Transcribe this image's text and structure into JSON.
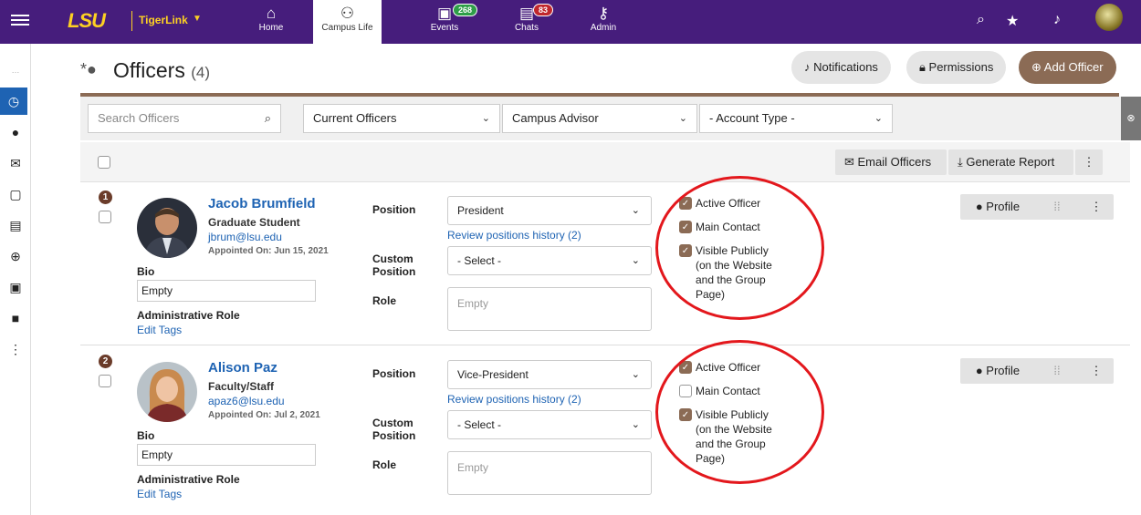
{
  "topbar": {
    "logo": "LSU",
    "brand": "TigerLink",
    "nav": [
      {
        "label": "Home",
        "icon": "home-icon"
      },
      {
        "label": "Campus Life",
        "icon": "campus-life-icon"
      },
      {
        "label": "Events",
        "icon": "calendar-icon",
        "badge": "268"
      },
      {
        "label": "Chats",
        "icon": "chat-icon",
        "badge": "83"
      },
      {
        "label": "Admin",
        "icon": "key-icon"
      }
    ]
  },
  "page": {
    "title": "Officers",
    "count": "(4)"
  },
  "actions": {
    "notifications": "Notifications",
    "permissions": "Permissions",
    "add": "Add Officer"
  },
  "filters": {
    "search_placeholder": "Search Officers",
    "status": "Current Officers",
    "advisor": "Campus Advisor",
    "account_type": "- Account Type -"
  },
  "bulk": {
    "email": "Email Officers",
    "report": "Generate Report"
  },
  "labels": {
    "position": "Position",
    "custom": "Custom",
    "custom2": "Position",
    "role": "Role",
    "bio": "Bio",
    "admin_role": "Administrative Role",
    "edit_tags": "Edit Tags",
    "review": "Review positions history (2)",
    "select": "- Select -",
    "empty": "Empty",
    "profile": "Profile",
    "active": "Active Officer",
    "main": "Main Contact",
    "visible": "Visible Publicly (on the Website and the Group Page)"
  },
  "officers": [
    {
      "num": "1",
      "name": "Jacob Brumfield",
      "type": "Graduate Student",
      "email": "jbrum@lsu.edu",
      "appointed": "Appointed On: Jun 15, 2021",
      "position": "President",
      "bio": "Empty",
      "role": "Empty",
      "active": true,
      "main": true,
      "visible": true
    },
    {
      "num": "2",
      "name": "Alison Paz",
      "type": "Faculty/Staff",
      "email": "apaz6@lsu.edu",
      "appointed": "Appointed On: Jul 2, 2021",
      "position": "Vice-President",
      "bio": "Empty",
      "role": "Empty",
      "active": true,
      "main": false,
      "visible": true
    }
  ],
  "colors": {
    "brand": "#461d7c",
    "accent": "#8b6b55",
    "link": "#1e63b3",
    "annotation": "#e3171c"
  }
}
